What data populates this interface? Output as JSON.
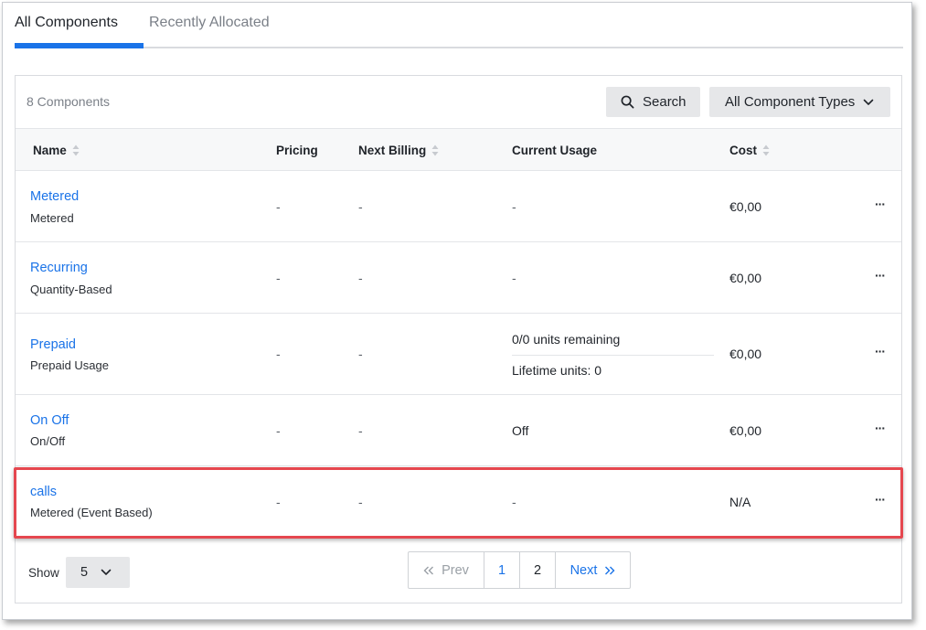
{
  "tabs": [
    {
      "label": "All Components",
      "active": true
    },
    {
      "label": "Recently Allocated",
      "active": false
    }
  ],
  "panel": {
    "count_label": "8 Components",
    "search_label": "Search",
    "types_label": "All Component Types"
  },
  "columns": {
    "name": "Name",
    "pricing": "Pricing",
    "next_billing": "Next Billing",
    "current_usage": "Current Usage",
    "cost": "Cost"
  },
  "rows": [
    {
      "name": "Metered",
      "type": "Metered",
      "pricing": "-",
      "next_billing": "-",
      "usage": "-",
      "cost": "€0,00",
      "more": "···"
    },
    {
      "name": "Recurring",
      "type": "Quantity-Based",
      "pricing": "-",
      "next_billing": "-",
      "usage": "-",
      "cost": "€0,00",
      "more": "···"
    },
    {
      "name": "Prepaid",
      "type": "Prepaid Usage",
      "pricing": "-",
      "next_billing": "-",
      "usage": "0/0 units remaining",
      "usage2": "Lifetime units: 0",
      "cost": "€0,00",
      "more": "···"
    },
    {
      "name": "On Off",
      "type": "On/Off",
      "pricing": "-",
      "next_billing": "-",
      "usage": "Off",
      "cost": "€0,00",
      "more": "···"
    },
    {
      "name": "calls",
      "type": "Metered (Event Based)",
      "pricing": "-",
      "next_billing": "-",
      "usage": "-",
      "cost": "N/A",
      "more": "···",
      "highlighted": true
    }
  ],
  "footer": {
    "show_label": "Show",
    "page_size": "5",
    "prev_label": "Prev",
    "pages": [
      "1",
      "2"
    ],
    "current_page": "1",
    "next_label": "Next"
  },
  "colors": {
    "accent": "#1a73e8",
    "highlight_border": "#e5474f",
    "button_bg": "#e6e7e9"
  },
  "icons": [
    "search-icon",
    "chevron-down-icon",
    "sort-icon",
    "more-icon",
    "double-chevron-left-icon",
    "double-chevron-right-icon"
  ]
}
